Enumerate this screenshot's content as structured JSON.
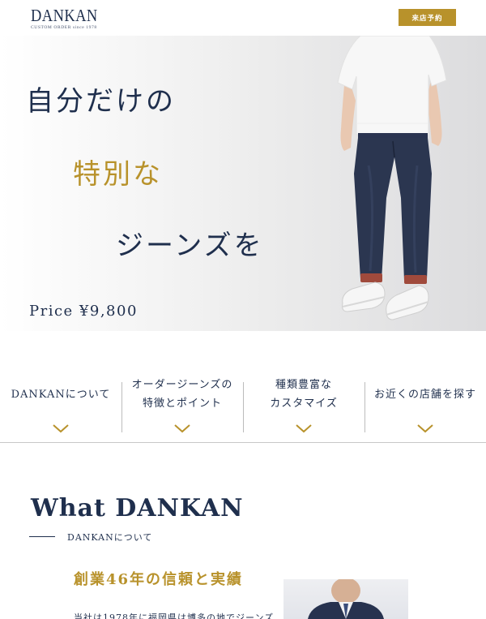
{
  "header": {
    "logo_main": "DANKAN",
    "logo_sub": "CUSTOM ORDER since 1978",
    "visit_button": "来店予約"
  },
  "hero": {
    "line1": "自分だけの",
    "line2": "特別な",
    "line3": "ジーンズを",
    "price": "Price ¥9,800"
  },
  "nav": {
    "items": [
      {
        "label": "DANKANについて"
      },
      {
        "label": "オーダージーンズの\n特徴とポイント"
      },
      {
        "label": "種類豊富な\nカスタマイズ"
      },
      {
        "label": "お近くの店舗を探す"
      }
    ]
  },
  "about": {
    "title": "What DANKAN",
    "subtitle": "DANKANについて",
    "heading": "創業46年の信頼と実績",
    "body": "当社は1978年に福岡県は博多の地でジーンズ"
  },
  "colors": {
    "navy": "#1f2f4d",
    "gold": "#b8922b"
  },
  "icons": [
    "chevron-down-icon"
  ]
}
